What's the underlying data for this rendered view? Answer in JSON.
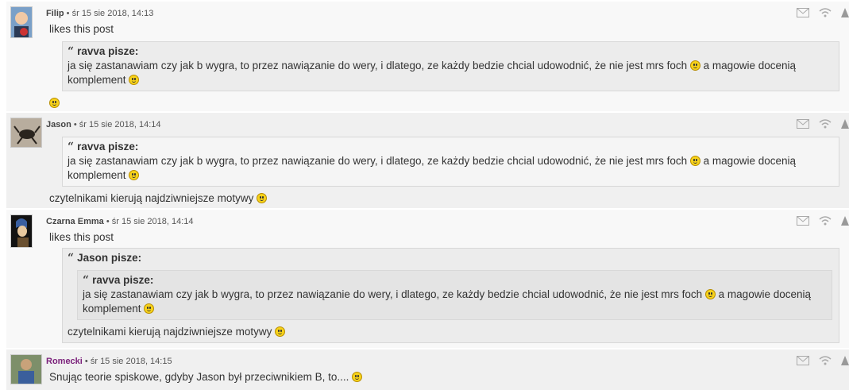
{
  "posts": [
    {
      "author": "Filip",
      "date": "śr 15 sie 2018, 14:13",
      "intro": "likes this post",
      "quote_author": "ravva pisze:",
      "quote_text": "ja się zastanawiam czy jak b wygra, to przez nawiązanie do wery, i dlatego, ze każdy bedzie chcial udowodnić, że nie jest mrs foch",
      "quote_text_2": "a magowie docenią komplement"
    },
    {
      "author": "Jason",
      "date": "śr 15 sie 2018, 14:14",
      "quote_author": "ravva pisze:",
      "quote_text": "ja się zastanawiam czy jak b wygra, to przez nawiązanie do wery, i dlatego, ze każdy bedzie chcial udowodnić, że nie jest mrs foch",
      "quote_text_2": "a magowie docenią komplement",
      "reply": "czytelnikami kierują najdziwniejsze motywy"
    },
    {
      "author": "Czarna Emma",
      "date": "śr 15 sie 2018, 14:14",
      "intro": "likes this post",
      "outer_quote_author": "Jason pisze:",
      "quote_author": "ravva pisze:",
      "quote_text": "ja się zastanawiam czy jak b wygra, to przez nawiązanie do wery, i dlatego, ze każdy bedzie chcial udowodnić, że nie jest mrs foch",
      "quote_text_2": "a magowie docenią komplement",
      "outer_reply": "czytelnikami kierują najdziwniejsze motywy"
    },
    {
      "author": "Romecki",
      "date": "śr 15 sie 2018, 14:15",
      "reply": "Snując teorie spiskowe, gdyby Jason był przeciwnikiem B, to...."
    }
  ],
  "colors": {
    "author_highlight": "#7a1f7a",
    "smiley": "#f7d21a"
  },
  "icons": [
    "mail-icon",
    "wifi-icon",
    "warning-icon"
  ]
}
